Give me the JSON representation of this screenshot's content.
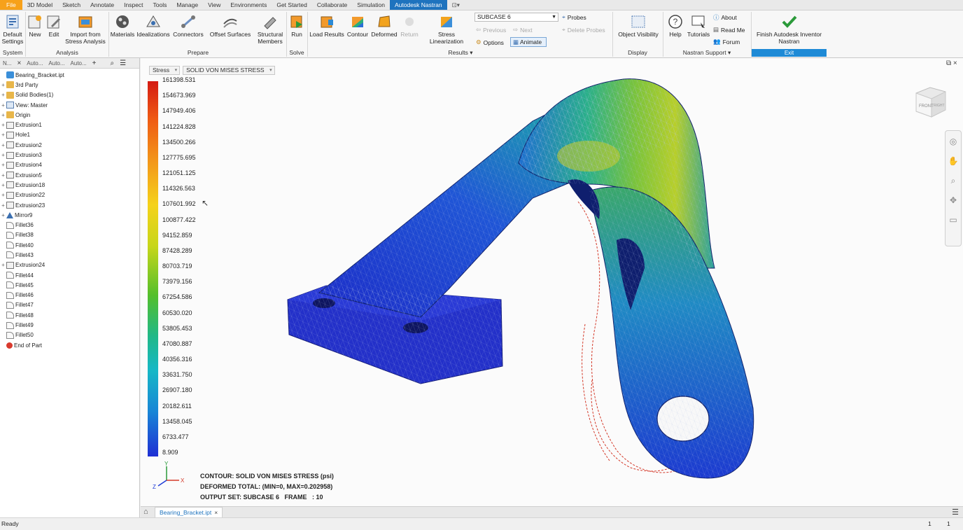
{
  "menu": {
    "tabs": [
      "File",
      "3D Model",
      "Sketch",
      "Annotate",
      "Inspect",
      "Tools",
      "Manage",
      "View",
      "Environments",
      "Get Started",
      "Collaborate",
      "Simulation",
      "Autodesk Nastran"
    ],
    "extra": "⊡▾"
  },
  "ribbon": {
    "default_settings": "Default Settings",
    "new": "New",
    "edit": "Edit",
    "import_stress": "Import from Stress Analysis",
    "materials": "Materials",
    "idealizations": "Idealizations",
    "connectors": "Connectors",
    "offset_surfaces": "Offset Surfaces",
    "structural_members": "Structural Members",
    "run": "Run",
    "load_results": "Load Results",
    "contour": "Contour",
    "deformed": "Deformed",
    "return": "Return",
    "stress_linearization": "Stress Linearization",
    "subcase": "SUBCASE 6",
    "previous": "Previous",
    "next": "Next",
    "options": "Options",
    "animate": "Animate",
    "probes": "Probes",
    "delete_probes": "Delete Probes",
    "object_visibility": "Object Visibility",
    "help": "Help",
    "tutorials": "Tutorials",
    "about": "About",
    "read_me": "Read Me",
    "forum": "Forum",
    "finish": "Finish Autodesk Inventor Nastran",
    "panels": {
      "system": "System",
      "analysis": "Analysis",
      "prepare": "Prepare",
      "solve": "Solve",
      "results": "Results ▾",
      "display": "Display",
      "nastran_support": "Nastran Support ▾",
      "exit": "Exit"
    }
  },
  "browser": {
    "tabs": [
      "N...",
      "Auto...",
      "Auto...",
      "Auto..."
    ],
    "items": [
      {
        "label": "Bearing_Bracket.ipt",
        "icon": "part-icon",
        "exp": ""
      },
      {
        "label": "3rd Party",
        "icon": "folder-icon",
        "exp": "+"
      },
      {
        "label": "Solid Bodies(1)",
        "icon": "folder-icon",
        "exp": "+"
      },
      {
        "label": "View: Master",
        "icon": "view-icon",
        "exp": "+"
      },
      {
        "label": "Origin",
        "icon": "folder-icon",
        "exp": "+"
      },
      {
        "label": "Extrusion1",
        "icon": "extrusion-icon",
        "exp": "+"
      },
      {
        "label": "Hole1",
        "icon": "hole-icon",
        "exp": "+"
      },
      {
        "label": "Extrusion2",
        "icon": "extrusion-icon",
        "exp": "+"
      },
      {
        "label": "Extrusion3",
        "icon": "extrusion-icon",
        "exp": "+"
      },
      {
        "label": "Extrusion4",
        "icon": "extrusion-icon",
        "exp": "+"
      },
      {
        "label": "Extrusion5",
        "icon": "extrusion-icon",
        "exp": "+"
      },
      {
        "label": "Extrusion18",
        "icon": "extrusion-icon",
        "exp": "+"
      },
      {
        "label": "Extrusion22",
        "icon": "extrusion-icon",
        "exp": "+"
      },
      {
        "label": "Extrusion23",
        "icon": "extrusion-icon",
        "exp": "+"
      },
      {
        "label": "Mirror9",
        "icon": "mirror-icon",
        "exp": "+"
      },
      {
        "label": "Fillet36",
        "icon": "fillet-icon",
        "exp": ""
      },
      {
        "label": "Fillet38",
        "icon": "fillet-icon",
        "exp": ""
      },
      {
        "label": "Fillet40",
        "icon": "fillet-icon",
        "exp": ""
      },
      {
        "label": "Fillet43",
        "icon": "fillet-icon",
        "exp": ""
      },
      {
        "label": "Extrusion24",
        "icon": "extrusion-icon",
        "exp": "+"
      },
      {
        "label": "Fillet44",
        "icon": "fillet-icon",
        "exp": ""
      },
      {
        "label": "Fillet45",
        "icon": "fillet-icon",
        "exp": ""
      },
      {
        "label": "Fillet46",
        "icon": "fillet-icon",
        "exp": ""
      },
      {
        "label": "Fillet47",
        "icon": "fillet-icon",
        "exp": ""
      },
      {
        "label": "Fillet48",
        "icon": "fillet-icon",
        "exp": ""
      },
      {
        "label": "Fillet49",
        "icon": "fillet-icon",
        "exp": ""
      },
      {
        "label": "Fillet50",
        "icon": "fillet-icon",
        "exp": ""
      },
      {
        "label": "End of Part",
        "icon": "end-of-part-icon",
        "exp": ""
      }
    ]
  },
  "viewport": {
    "result_type": "Stress",
    "result_component": "SOLID VON MISES STRESS",
    "legend": [
      "161398.531",
      "154673.969",
      "147949.406",
      "141224.828",
      "134500.266",
      "127775.695",
      "121051.125",
      "114326.563",
      "107601.992",
      "100877.422",
      "94152.859",
      "87428.289",
      "80703.719",
      "73979.156",
      "67254.586",
      "60530.020",
      "53805.453",
      "47080.887",
      "40356.316",
      "33631.750",
      "26907.180",
      "20182.611",
      "13458.045",
      "6733.477",
      "8.909"
    ],
    "info": {
      "contour": "CONTOUR: SOLID VON MISES STRESS (psi)",
      "deformed": "DEFORMED TOTAL: (MIN=0, MAX=0.202958)",
      "output": "OUTPUT SET: SUBCASE 6   FRAME   : 10"
    },
    "axis": {
      "x": "X",
      "y": "Y",
      "z": "Z"
    },
    "viewcube": {
      "front": "FRONT",
      "right": "RIGHT"
    }
  },
  "docbar": {
    "tab": "Bearing_Bracket.ipt",
    "close": "×"
  },
  "status": {
    "text": "Ready",
    "count1": "1",
    "count2": "1"
  }
}
